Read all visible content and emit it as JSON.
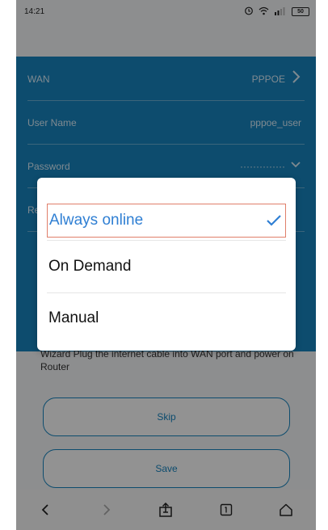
{
  "status_bar": {
    "time": "14:21",
    "battery": "50"
  },
  "form": {
    "wan_label": "WAN",
    "wan_value": "PPPOE",
    "username_label": "User Name",
    "username_value": "pppoe_user",
    "password_label": "Password",
    "password_value": "··············",
    "reconnect_label_partial": "Re"
  },
  "hint": "Wizard Plug the internet cable into WAN port and power on Router",
  "buttons": {
    "skip": "Skip",
    "save": "Save"
  },
  "dialog": {
    "options": [
      {
        "label": "Always online",
        "selected": true
      },
      {
        "label": "On Demand",
        "selected": false
      },
      {
        "label": "Manual",
        "selected": false
      }
    ]
  },
  "colors": {
    "accent": "#1784be",
    "highlight_border": "#e07f6a",
    "check": "#2f7fd3"
  },
  "icons": {
    "status": [
      "alarm-icon",
      "wifi-icon",
      "signal-icon",
      "battery-icon"
    ],
    "nav": [
      "back-icon",
      "forward-icon",
      "share-icon",
      "tabs-icon",
      "home-icon"
    ]
  }
}
